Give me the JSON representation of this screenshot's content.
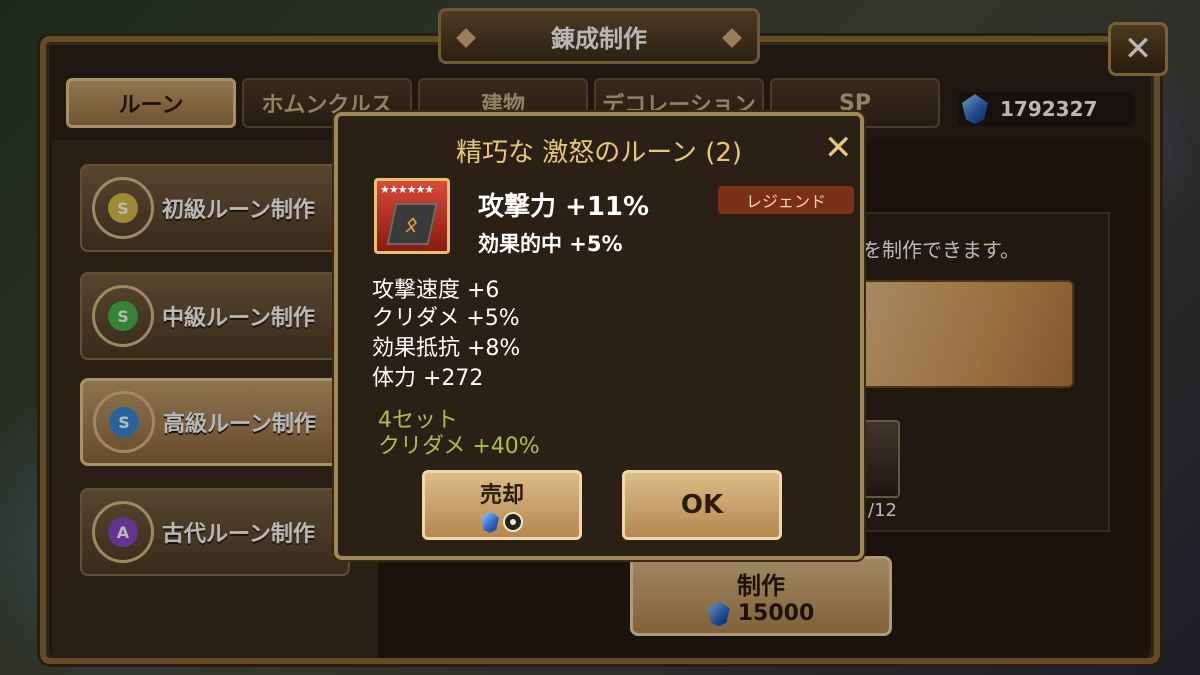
{
  "window": {
    "title": "錬成制作",
    "close_icon": "close-icon"
  },
  "tabs": [
    {
      "label": "ルーン",
      "active": true
    },
    {
      "label": "ホムンクルス",
      "active": false
    },
    {
      "label": "建物",
      "active": false
    },
    {
      "label": "デコレーション",
      "active": false
    },
    {
      "label": "SP",
      "active": false
    }
  ],
  "currency": {
    "icon": "crystal-icon",
    "amount": "1792327"
  },
  "craft_list": [
    {
      "label": "初級ルーン制作",
      "color": "#d8c048",
      "glyph": "S",
      "selected": false
    },
    {
      "label": "中級ルーン制作",
      "color": "#4ab848",
      "glyph": "S",
      "selected": false
    },
    {
      "label": "高級ルーン制作",
      "color": "#3a8ad8",
      "glyph": "S",
      "selected": true
    },
    {
      "label": "古代ルーン制作",
      "color": "#8a48c8",
      "glyph": "A",
      "selected": false
    }
  ],
  "detail": {
    "description": "を制作できます。",
    "count": "/12"
  },
  "craft_button": {
    "label": "制作",
    "cost": "15000"
  },
  "modal": {
    "title": "精巧な 激怒のルーン (2)",
    "stars": "★★★★★★",
    "main_stat": "攻撃力 +11%",
    "innate_stat": "効果的中 +5%",
    "grade": "レジェンド",
    "sub_stats": [
      "攻撃速度 +6",
      "クリダメ +5%",
      "効果抵抗 +8%",
      "体力 +272"
    ],
    "set_bonus": [
      "4セット",
      "クリダメ +40%"
    ],
    "sell_label": "売却",
    "ok_label": "OK"
  }
}
